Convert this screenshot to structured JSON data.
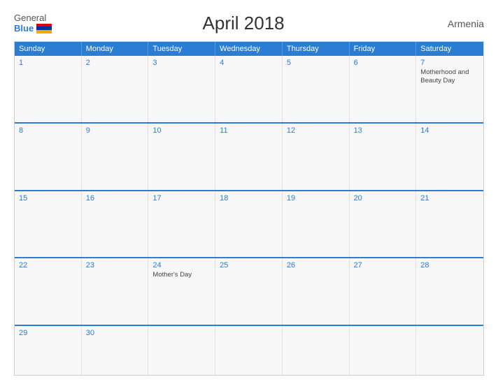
{
  "header": {
    "logo_general": "General",
    "logo_blue": "Blue",
    "title": "April 2018",
    "country": "Armenia"
  },
  "days_of_week": [
    "Sunday",
    "Monday",
    "Tuesday",
    "Wednesday",
    "Thursday",
    "Friday",
    "Saturday"
  ],
  "weeks": [
    [
      {
        "day": "1",
        "events": []
      },
      {
        "day": "2",
        "events": []
      },
      {
        "day": "3",
        "events": []
      },
      {
        "day": "4",
        "events": []
      },
      {
        "day": "5",
        "events": []
      },
      {
        "day": "6",
        "events": []
      },
      {
        "day": "7",
        "events": [
          "Motherhood and Beauty Day"
        ]
      }
    ],
    [
      {
        "day": "8",
        "events": []
      },
      {
        "day": "9",
        "events": []
      },
      {
        "day": "10",
        "events": []
      },
      {
        "day": "11",
        "events": []
      },
      {
        "day": "12",
        "events": []
      },
      {
        "day": "13",
        "events": []
      },
      {
        "day": "14",
        "events": []
      }
    ],
    [
      {
        "day": "15",
        "events": []
      },
      {
        "day": "16",
        "events": []
      },
      {
        "day": "17",
        "events": []
      },
      {
        "day": "18",
        "events": []
      },
      {
        "day": "19",
        "events": []
      },
      {
        "day": "20",
        "events": []
      },
      {
        "day": "21",
        "events": []
      }
    ],
    [
      {
        "day": "22",
        "events": []
      },
      {
        "day": "23",
        "events": []
      },
      {
        "day": "24",
        "events": [
          "Mother's Day"
        ]
      },
      {
        "day": "25",
        "events": []
      },
      {
        "day": "26",
        "events": []
      },
      {
        "day": "27",
        "events": []
      },
      {
        "day": "28",
        "events": []
      }
    ],
    [
      {
        "day": "29",
        "events": []
      },
      {
        "day": "30",
        "events": []
      },
      {
        "day": "",
        "events": []
      },
      {
        "day": "",
        "events": []
      },
      {
        "day": "",
        "events": []
      },
      {
        "day": "",
        "events": []
      },
      {
        "day": "",
        "events": []
      }
    ]
  ]
}
